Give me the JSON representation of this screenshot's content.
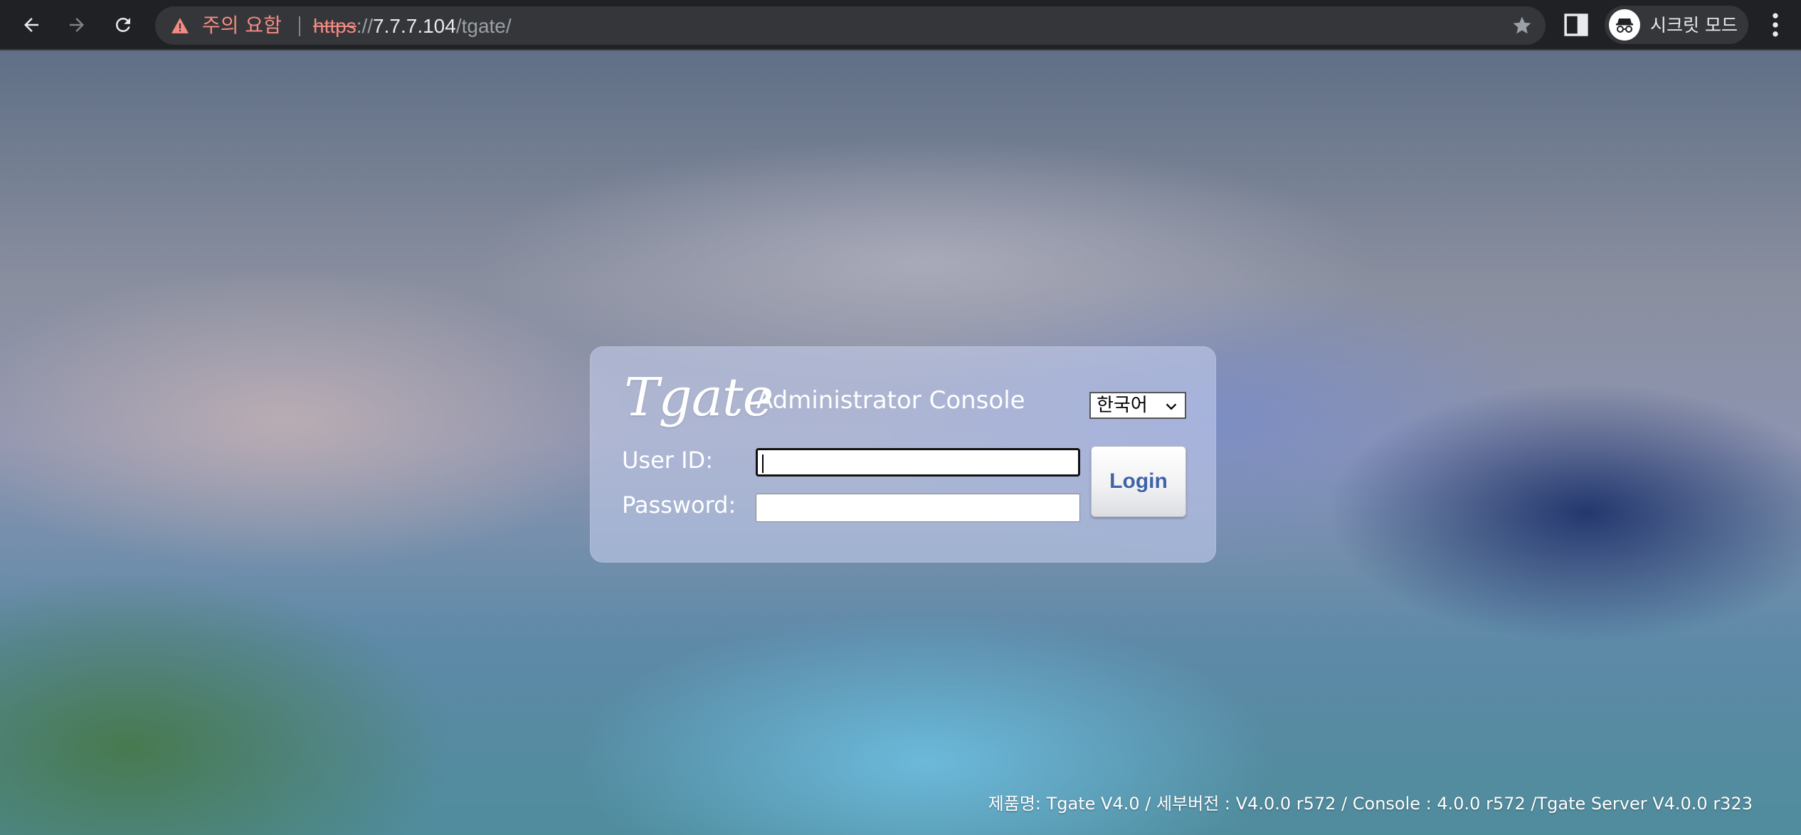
{
  "browser": {
    "warning_text": "주의 요함",
    "url": {
      "scheme": "https",
      "separator": "://",
      "host": "7.7.7.104",
      "path": "/tgate/"
    },
    "incognito_label": "시크릿 모드",
    "icons": {
      "back": "back-arrow-icon",
      "forward": "forward-arrow-icon",
      "reload": "reload-icon",
      "warning": "warning-triangle-icon",
      "bookmark": "star-icon",
      "side_panel": "side-panel-icon",
      "incognito": "incognito-icon",
      "menu": "kebab-menu-icon"
    },
    "colors": {
      "toolbar": "#202124",
      "omnibox": "#35363a",
      "warning": "#f28b82"
    }
  },
  "login": {
    "brand": "Tgate",
    "title": "Administrator Console",
    "language_selected": "한국어",
    "user_id_label": "User ID:",
    "password_label": "Password:",
    "user_id_value": "",
    "password_value": "",
    "login_button": "Login",
    "colors": {
      "login_text": "#3f63a8"
    }
  },
  "footer": {
    "version_text": "제품명: Tgate V4.0 / 세부버전 : V4.0.0 r572 / Console : 4.0.0 r572 /Tgate Server V4.0.0 r323"
  }
}
